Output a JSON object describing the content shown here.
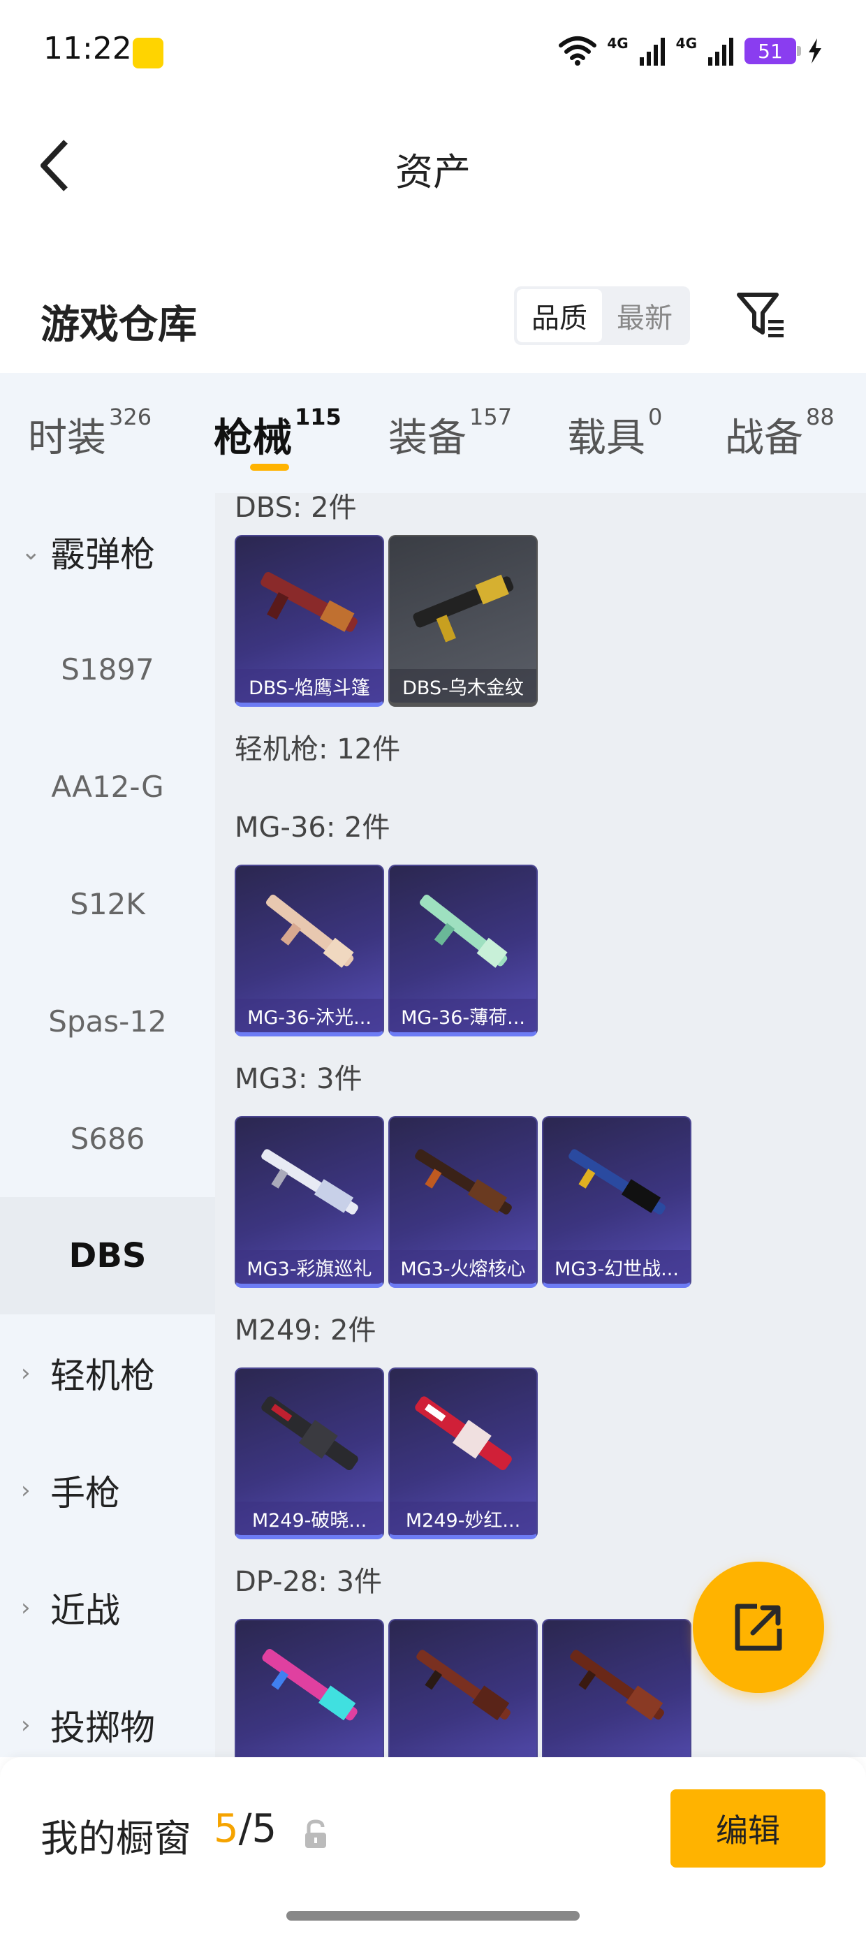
{
  "status_bar": {
    "time": "11:22",
    "network_1": "4G",
    "network_2": "4G",
    "battery": "51"
  },
  "header": {
    "title": "资产"
  },
  "section": {
    "title": "游戏仓库",
    "sort_quality": "品质",
    "sort_newest": "最新"
  },
  "tabs": [
    {
      "label": "时装",
      "count": "326"
    },
    {
      "label": "枪械",
      "count": "115"
    },
    {
      "label": "装备",
      "count": "157"
    },
    {
      "label": "载具",
      "count": "0"
    },
    {
      "label": "战备",
      "count": "88"
    }
  ],
  "sidebar": {
    "group_shotgun": "霰弹枪",
    "items": [
      "S1897",
      "AA12-G",
      "S12K",
      "Spas-12",
      "S686",
      "DBS"
    ],
    "group_lmg": "轻机枪",
    "group_pistol": "手枪",
    "group_melee": "近战",
    "group_throwable": "投掷物"
  },
  "content": {
    "dbs_label": "DBS: 2件",
    "dbs_cards": [
      "DBS-焰鹰斗篷",
      "DBS-乌木金纹"
    ],
    "lmg_label": "轻机枪: 12件",
    "mg36_label": "MG-36: 2件",
    "mg36_cards": [
      "MG-36-沐光...",
      "MG-36-薄荷..."
    ],
    "mg3_label": "MG3: 3件",
    "mg3_cards": [
      "MG3-彩旗巡礼",
      "MG3-火熔核心",
      "MG3-幻世战..."
    ],
    "m249_label": "M249: 2件",
    "m249_cards": [
      "M249-破晓...",
      "M249-妙红..."
    ],
    "dp28_label": "DP-28: 3件"
  },
  "bottom_bar": {
    "showcase_label": "我的橱窗",
    "showcase_current": "5",
    "showcase_total": "/5",
    "edit_label": "编辑"
  },
  "colors": {
    "accent": "#ffb300",
    "tab_bg": "#f1f5fa",
    "content_bg": "#eceff3",
    "card_purple": "#3c3580"
  }
}
